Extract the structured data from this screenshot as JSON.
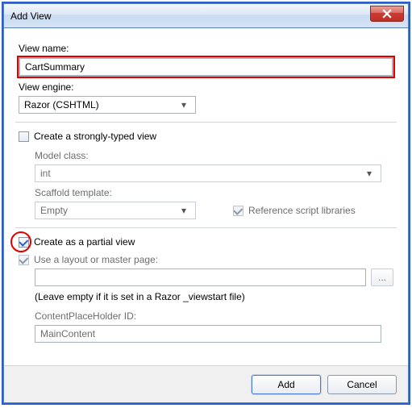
{
  "window": {
    "title": "Add View"
  },
  "labels": {
    "viewName": "View name:",
    "viewEngine": "View engine:",
    "stronglyTyped": "Create a strongly-typed view",
    "modelClass": "Model class:",
    "scaffoldTemplate": "Scaffold template:",
    "refScripts": "Reference script libraries",
    "partialView": "Create as a partial view",
    "useLayout": "Use a layout or master page:",
    "leaveEmpty": "(Leave empty if it is set in a Razor _viewstart file)",
    "placeholderId": "ContentPlaceHolder ID:"
  },
  "values": {
    "viewName": "CartSummary",
    "viewEngine": "Razor (CSHTML)",
    "modelClass": "int",
    "scaffoldTemplate": "Empty",
    "layoutPath": "",
    "placeholderId": "MainContent",
    "browse": "..."
  },
  "checks": {
    "stronglyTyped": false,
    "refScripts": true,
    "partialView": true,
    "useLayout": true
  },
  "buttons": {
    "add": "Add",
    "cancel": "Cancel"
  }
}
